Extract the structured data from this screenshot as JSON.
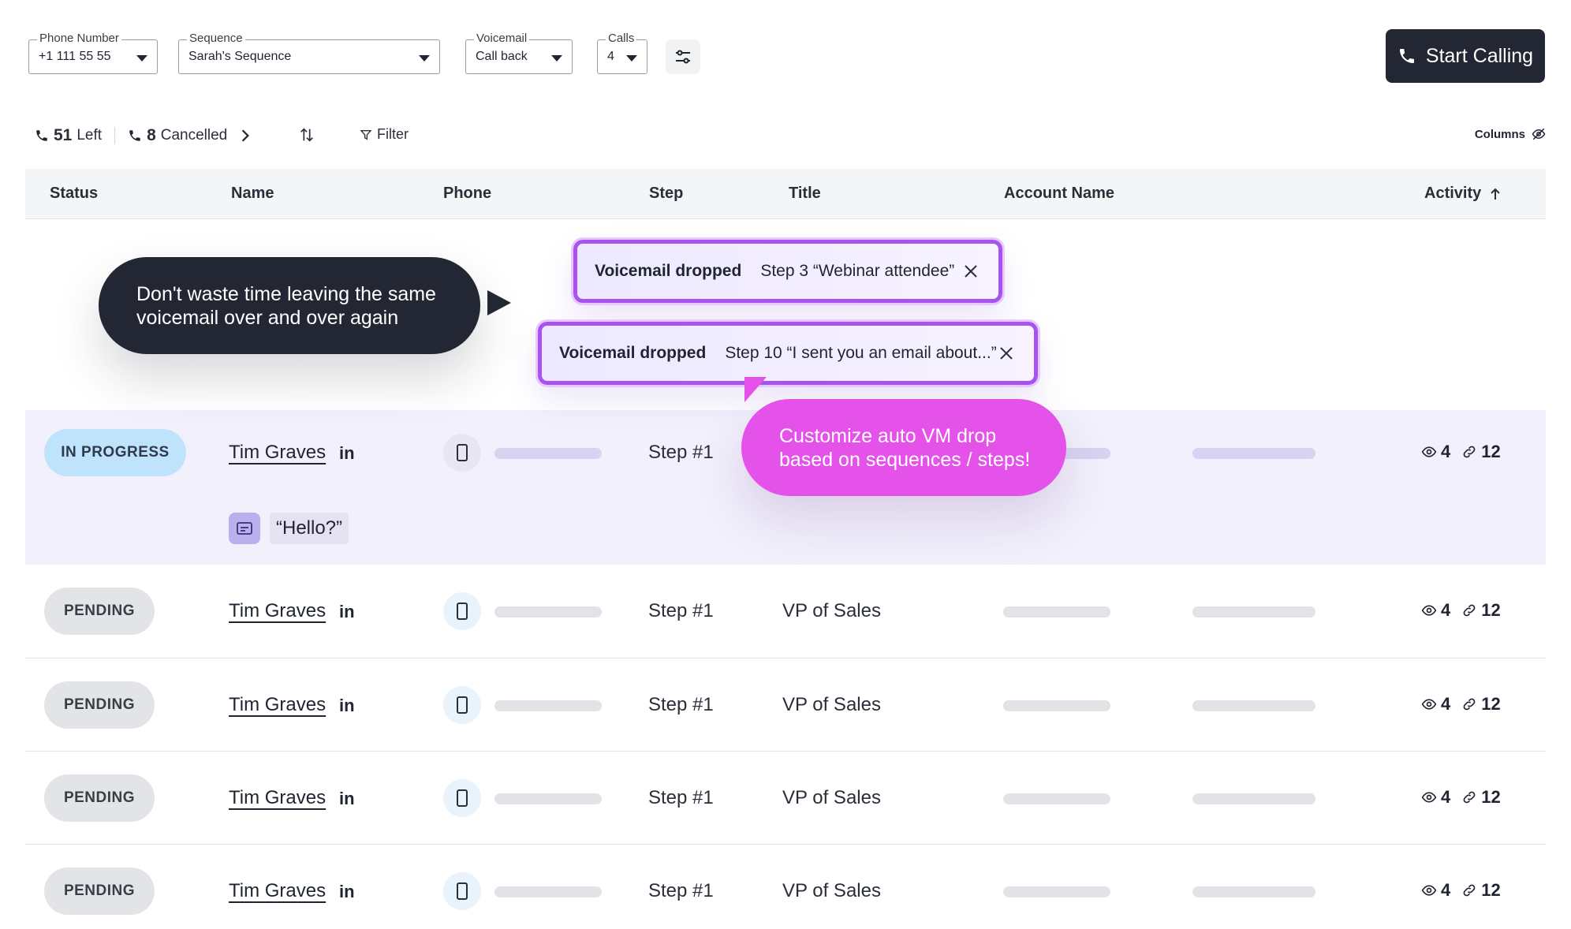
{
  "filters": {
    "phone_number": {
      "label": "Phone Number",
      "value": "+1 111 55 55"
    },
    "sequence": {
      "label": "Sequence",
      "value": "Sarah's Sequence"
    },
    "voicemail": {
      "label": "Voicemail",
      "value": "Call back"
    },
    "calls": {
      "label": "Calls",
      "value": "4"
    }
  },
  "start_button": "Start Calling",
  "counters": {
    "left_count": "51",
    "left_label": "Left",
    "cancelled_count": "8",
    "cancelled_label": "Cancelled"
  },
  "filter_label": "Filter",
  "columns_label": "Columns",
  "headers": {
    "status": "Status",
    "name": "Name",
    "phone": "Phone",
    "step": "Step",
    "title": "Title",
    "account": "Account Name",
    "activity": "Activity"
  },
  "rows": [
    {
      "status": "IN PROGRESS",
      "name": "Tim Graves",
      "linkedin": "in",
      "step": "Step #1",
      "title": "",
      "views": "4",
      "links": "12",
      "transcript": "“Hello?”"
    },
    {
      "status": "PENDING",
      "name": "Tim Graves",
      "linkedin": "in",
      "step": "Step #1",
      "title": "VP of Sales",
      "views": "4",
      "links": "12"
    },
    {
      "status": "PENDING",
      "name": "Tim Graves",
      "linkedin": "in",
      "step": "Step #1",
      "title": "VP of Sales",
      "views": "4",
      "links": "12"
    },
    {
      "status": "PENDING",
      "name": "Tim Graves",
      "linkedin": "in",
      "step": "Step #1",
      "title": "VP of Sales",
      "views": "4",
      "links": "12"
    },
    {
      "status": "PENDING",
      "name": "Tim Graves",
      "linkedin": "in",
      "step": "Step #1",
      "title": "VP of Sales",
      "views": "4",
      "links": "12"
    }
  ],
  "callouts": {
    "dark": "Don't waste time leaving the same voicemail over and over again",
    "pink": "Customize auto VM drop based on sequences / steps!"
  },
  "toasts": [
    {
      "title": "Voicemail dropped",
      "detail": "Step 3 “Webinar attendee”"
    },
    {
      "title": "Voicemail dropped",
      "detail": "Step 10 “I sent you an email about...”"
    }
  ],
  "colors": {
    "accent_dark": "#232733",
    "accent_pink": "#e552ea",
    "toast_border": "#a653f0",
    "in_progress": "#bfe3fb"
  }
}
